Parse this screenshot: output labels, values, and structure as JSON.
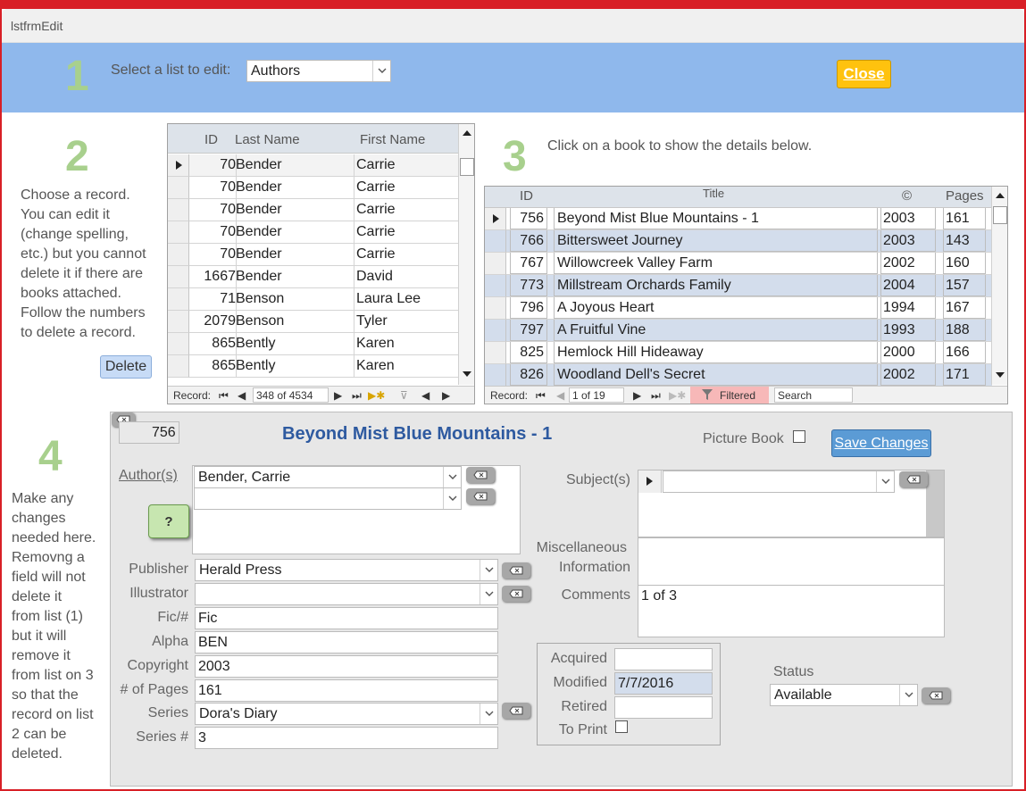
{
  "window": {
    "title": "lstfrmEdit"
  },
  "steps": {
    "one": "1",
    "two": "2",
    "three": "3",
    "four": "4"
  },
  "header": {
    "select_label": "Select a list to edit:",
    "list_value": "Authors",
    "close_label": "Close"
  },
  "step2": {
    "instructions": [
      "Choose a record.",
      "You can edit it",
      "(change spelling,",
      "etc.) but you cannot",
      "delete it if there are",
      "books attached.",
      "Follow the numbers",
      "to delete a record."
    ],
    "delete_label": "Delete"
  },
  "authors": {
    "columns": {
      "id": "ID",
      "last": "Last Name",
      "first": "First Name"
    },
    "rows": [
      {
        "id": "70",
        "last": "Bender",
        "first": "Carrie"
      },
      {
        "id": "70",
        "last": "Bender",
        "first": "Carrie"
      },
      {
        "id": "70",
        "last": "Bender",
        "first": "Carrie"
      },
      {
        "id": "70",
        "last": "Bender",
        "first": "Carrie"
      },
      {
        "id": "70",
        "last": "Bender",
        "first": "Carrie"
      },
      {
        "id": "1667",
        "last": "Bender",
        "first": "David"
      },
      {
        "id": "71",
        "last": "Benson",
        "first": "Laura Lee"
      },
      {
        "id": "2079",
        "last": "Benson",
        "first": "Tyler"
      },
      {
        "id": "865",
        "last": "Bently",
        "first": "Karen"
      },
      {
        "id": "865",
        "last": "Bently",
        "first": "Karen"
      }
    ],
    "nav": {
      "record_label": "Record:",
      "position": "348 of 4534"
    }
  },
  "step3": {
    "instruction": "Click on a book to show the details below."
  },
  "books": {
    "columns": {
      "id": "ID",
      "title": "Title",
      "copyright": "©",
      "pages": "Pages"
    },
    "rows": [
      {
        "id": "756",
        "title": "Beyond Mist Blue Mountains - 1",
        "year": "2003",
        "pages": "161"
      },
      {
        "id": "766",
        "title": "Bittersweet Journey",
        "year": "2003",
        "pages": "143"
      },
      {
        "id": "767",
        "title": "Willowcreek Valley Farm",
        "year": "2002",
        "pages": "160"
      },
      {
        "id": "773",
        "title": "Millstream Orchards Family",
        "year": "2004",
        "pages": "157"
      },
      {
        "id": "796",
        "title": "A Joyous Heart",
        "year": "1994",
        "pages": "167"
      },
      {
        "id": "797",
        "title": "A Fruitful Vine",
        "year": "1993",
        "pages": "188"
      },
      {
        "id": "825",
        "title": "Hemlock Hill Hideaway",
        "year": "2000",
        "pages": "166"
      },
      {
        "id": "826",
        "title": "Woodland Dell's Secret",
        "year": "2002",
        "pages": "171"
      }
    ],
    "nav": {
      "record_label": "Record:",
      "position": "1 of 19",
      "filtered_label": "Filtered",
      "search_placeholder": "Search"
    }
  },
  "step4": {
    "instructions": [
      "Make any",
      "changes",
      "needed here.",
      "Removng a",
      "field will not",
      "delete it",
      "from list (1)",
      "but it will",
      "remove it",
      "from list on 3",
      "so that the",
      "record on list",
      "2 can be",
      "deleted."
    ]
  },
  "detail": {
    "record_id": "756",
    "title": "Beyond Mist Blue Mountains - 1",
    "picture_book_label": "Picture Book",
    "save_label": "Save Changes",
    "authors_label": "Author(s)",
    "author1": "Bender, Carrie",
    "author2": "",
    "help_label": "?",
    "subjects_label": "Subject(s)",
    "misc_label_1": "Miscellaneous",
    "misc_label_2": "Information",
    "comments_label": "Comments",
    "comments_value": "1 of 3",
    "publisher_label": "Publisher",
    "publisher_value": "Herald Press",
    "illustrator_label": "Illustrator",
    "illustrator_value": "",
    "fic_label": "Fic/#",
    "fic_value": "Fic",
    "alpha_label": "Alpha",
    "alpha_value": "BEN",
    "copyright_label": "Copyright",
    "copyright_value": "2003",
    "pages_label": "# of Pages",
    "pages_value": "161",
    "series_label": "Series",
    "series_value": "Dora's Diary",
    "seriesnum_label": "Series #",
    "seriesnum_value": "3",
    "acquired_label": "Acquired",
    "modified_label": "Modified",
    "modified_value": "7/7/2016",
    "retired_label": "Retired",
    "toprint_label": "To Print",
    "status_label": "Status",
    "status_value": "Available"
  }
}
